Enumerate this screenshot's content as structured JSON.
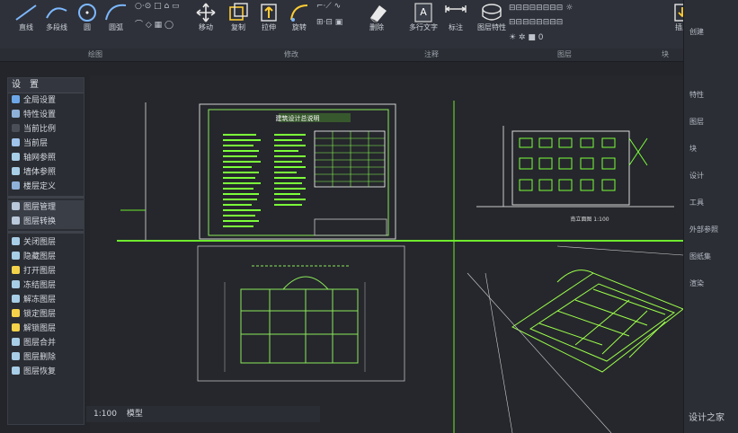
{
  "ribbon": {
    "tools": [
      {
        "label": "直线",
        "icon": "line-icon"
      },
      {
        "label": "多段线",
        "icon": "polyline-icon"
      },
      {
        "label": "圆",
        "icon": "circle-icon"
      },
      {
        "label": "圆弧",
        "icon": "arc-icon"
      },
      {
        "label": "移动",
        "icon": "move-icon"
      },
      {
        "label": "复制",
        "icon": "copy-icon"
      },
      {
        "label": "拉伸",
        "icon": "stretch-icon"
      },
      {
        "label": "旋转",
        "icon": "rotate-icon"
      },
      {
        "label": "删除",
        "icon": "eraser-icon"
      },
      {
        "label": "多行文字",
        "icon": "text-icon"
      },
      {
        "label": "标注",
        "icon": "dimension-icon"
      },
      {
        "label": "图层特性",
        "icon": "layer-icon"
      },
      {
        "label": "插入",
        "icon": "insert-icon"
      },
      {
        "label": "创建",
        "icon": "create-icon"
      }
    ],
    "groups": [
      "绘图",
      "修改",
      "注释",
      "图层",
      "块"
    ]
  },
  "panel": {
    "title": "设　置",
    "items_top": [
      "全局设置",
      "特性设置",
      "当前比例",
      "当前层",
      "轴网参照",
      "墙体参照",
      "楼层定义"
    ],
    "items_mid": [
      "图层管理",
      "图层转换"
    ],
    "items_bottom": [
      "关闭图层",
      "隐藏图层",
      "打开图层",
      "冻结图层",
      "解冻图层",
      "锁定图层",
      "解锁图层",
      "图层合并",
      "图层删除",
      "图层恢复"
    ]
  },
  "drawing": {
    "sheet_title": "建筑设计总说明",
    "elevation_caption": "南立面图 1:100"
  },
  "status": {
    "coords": "1:100",
    "mode": "模型"
  },
  "right_strip": [
    "特性",
    "图层",
    "块",
    "设计",
    "工具",
    "外部参照",
    "图纸集",
    "渲染"
  ],
  "watermark": "设计之家",
  "colors": {
    "accent": "#7cff3a",
    "bg": "#25272c"
  }
}
